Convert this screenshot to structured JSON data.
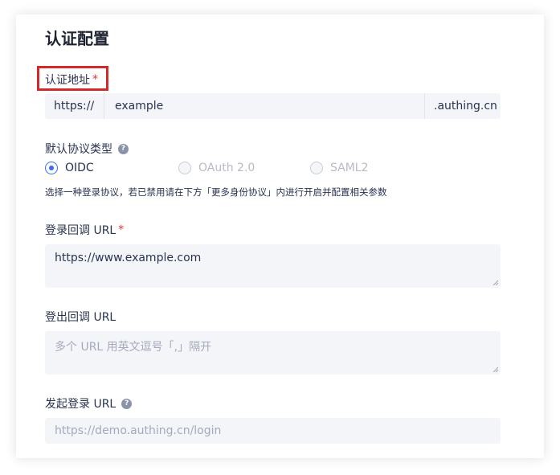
{
  "section": {
    "title": "认证配置"
  },
  "auth_address": {
    "label": "认证地址",
    "required_mark": "*",
    "prefix": "https://",
    "value": "example",
    "suffix": ".authing.cn"
  },
  "protocol": {
    "label": "默认协议类型",
    "help_icon": "?",
    "options": [
      {
        "label": "OIDC",
        "checked": true,
        "disabled": false
      },
      {
        "label": "OAuth 2.0",
        "checked": false,
        "disabled": true
      },
      {
        "label": "SAML2",
        "checked": false,
        "disabled": true
      }
    ],
    "hint": "选择一种登录协议，若已禁用请在下方「更多身份协议」内进行开启并配置相关参数"
  },
  "login_callback": {
    "label": "登录回调 URL",
    "required_mark": "*",
    "value": "https://www.example.com"
  },
  "logout_callback": {
    "label": "登出回调 URL",
    "placeholder": "多个 URL 用英文逗号「,」隔开"
  },
  "initiate_login": {
    "label": "发起登录 URL",
    "help_icon": "?",
    "placeholder": "https://demo.authing.cn/login"
  },
  "colors": {
    "accent": "#396aff",
    "required": "#e63333",
    "highlight": "#d62828",
    "input_bg": "#f3f5f8"
  }
}
